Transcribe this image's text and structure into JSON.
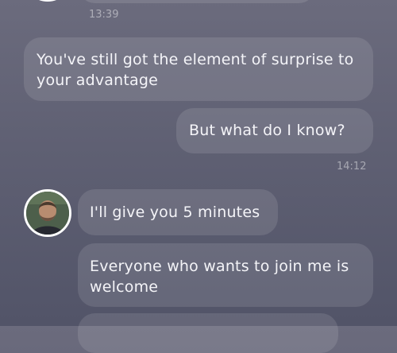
{
  "messages": [
    {
      "type": "avatar",
      "sender": "contact"
    },
    {
      "type": "timestamp",
      "text": "13:39"
    },
    {
      "type": "bubble",
      "sender": "contact",
      "text": "You've still got the element of surprise to your advantage"
    },
    {
      "type": "bubble",
      "sender": "me",
      "text": "But what do I know?"
    },
    {
      "type": "timestamp",
      "text": "14:12"
    },
    {
      "type": "avatar",
      "sender": "contact"
    },
    {
      "type": "bubble",
      "sender": "contact",
      "text": "I'll give you 5 minutes"
    },
    {
      "type": "bubble",
      "sender": "contact",
      "text": "Everyone who wants to join me is welcome"
    },
    {
      "type": "bubble",
      "sender": "contact",
      "text": ""
    }
  ]
}
